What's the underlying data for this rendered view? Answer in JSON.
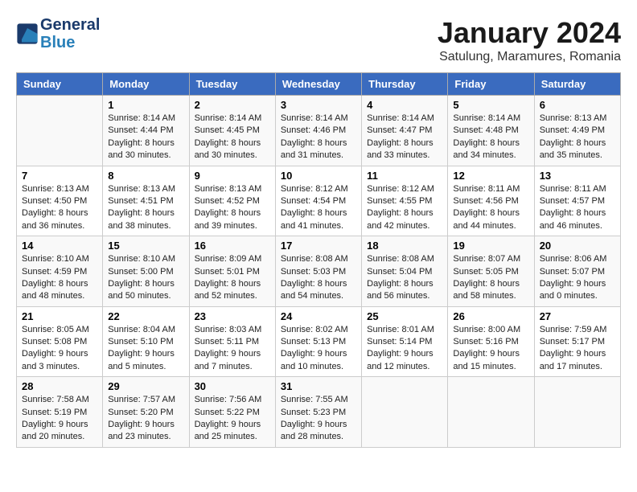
{
  "header": {
    "logo_line1": "General",
    "logo_line2": "Blue",
    "title": "January 2024",
    "subtitle": "Satulung, Maramures, Romania"
  },
  "weekdays": [
    "Sunday",
    "Monday",
    "Tuesday",
    "Wednesday",
    "Thursday",
    "Friday",
    "Saturday"
  ],
  "weeks": [
    [
      {
        "day": "",
        "info": ""
      },
      {
        "day": "1",
        "info": "Sunrise: 8:14 AM\nSunset: 4:44 PM\nDaylight: 8 hours\nand 30 minutes."
      },
      {
        "day": "2",
        "info": "Sunrise: 8:14 AM\nSunset: 4:45 PM\nDaylight: 8 hours\nand 30 minutes."
      },
      {
        "day": "3",
        "info": "Sunrise: 8:14 AM\nSunset: 4:46 PM\nDaylight: 8 hours\nand 31 minutes."
      },
      {
        "day": "4",
        "info": "Sunrise: 8:14 AM\nSunset: 4:47 PM\nDaylight: 8 hours\nand 33 minutes."
      },
      {
        "day": "5",
        "info": "Sunrise: 8:14 AM\nSunset: 4:48 PM\nDaylight: 8 hours\nand 34 minutes."
      },
      {
        "day": "6",
        "info": "Sunrise: 8:13 AM\nSunset: 4:49 PM\nDaylight: 8 hours\nand 35 minutes."
      }
    ],
    [
      {
        "day": "7",
        "info": "Sunrise: 8:13 AM\nSunset: 4:50 PM\nDaylight: 8 hours\nand 36 minutes."
      },
      {
        "day": "8",
        "info": "Sunrise: 8:13 AM\nSunset: 4:51 PM\nDaylight: 8 hours\nand 38 minutes."
      },
      {
        "day": "9",
        "info": "Sunrise: 8:13 AM\nSunset: 4:52 PM\nDaylight: 8 hours\nand 39 minutes."
      },
      {
        "day": "10",
        "info": "Sunrise: 8:12 AM\nSunset: 4:54 PM\nDaylight: 8 hours\nand 41 minutes."
      },
      {
        "day": "11",
        "info": "Sunrise: 8:12 AM\nSunset: 4:55 PM\nDaylight: 8 hours\nand 42 minutes."
      },
      {
        "day": "12",
        "info": "Sunrise: 8:11 AM\nSunset: 4:56 PM\nDaylight: 8 hours\nand 44 minutes."
      },
      {
        "day": "13",
        "info": "Sunrise: 8:11 AM\nSunset: 4:57 PM\nDaylight: 8 hours\nand 46 minutes."
      }
    ],
    [
      {
        "day": "14",
        "info": "Sunrise: 8:10 AM\nSunset: 4:59 PM\nDaylight: 8 hours\nand 48 minutes."
      },
      {
        "day": "15",
        "info": "Sunrise: 8:10 AM\nSunset: 5:00 PM\nDaylight: 8 hours\nand 50 minutes."
      },
      {
        "day": "16",
        "info": "Sunrise: 8:09 AM\nSunset: 5:01 PM\nDaylight: 8 hours\nand 52 minutes."
      },
      {
        "day": "17",
        "info": "Sunrise: 8:08 AM\nSunset: 5:03 PM\nDaylight: 8 hours\nand 54 minutes."
      },
      {
        "day": "18",
        "info": "Sunrise: 8:08 AM\nSunset: 5:04 PM\nDaylight: 8 hours\nand 56 minutes."
      },
      {
        "day": "19",
        "info": "Sunrise: 8:07 AM\nSunset: 5:05 PM\nDaylight: 8 hours\nand 58 minutes."
      },
      {
        "day": "20",
        "info": "Sunrise: 8:06 AM\nSunset: 5:07 PM\nDaylight: 9 hours\nand 0 minutes."
      }
    ],
    [
      {
        "day": "21",
        "info": "Sunrise: 8:05 AM\nSunset: 5:08 PM\nDaylight: 9 hours\nand 3 minutes."
      },
      {
        "day": "22",
        "info": "Sunrise: 8:04 AM\nSunset: 5:10 PM\nDaylight: 9 hours\nand 5 minutes."
      },
      {
        "day": "23",
        "info": "Sunrise: 8:03 AM\nSunset: 5:11 PM\nDaylight: 9 hours\nand 7 minutes."
      },
      {
        "day": "24",
        "info": "Sunrise: 8:02 AM\nSunset: 5:13 PM\nDaylight: 9 hours\nand 10 minutes."
      },
      {
        "day": "25",
        "info": "Sunrise: 8:01 AM\nSunset: 5:14 PM\nDaylight: 9 hours\nand 12 minutes."
      },
      {
        "day": "26",
        "info": "Sunrise: 8:00 AM\nSunset: 5:16 PM\nDaylight: 9 hours\nand 15 minutes."
      },
      {
        "day": "27",
        "info": "Sunrise: 7:59 AM\nSunset: 5:17 PM\nDaylight: 9 hours\nand 17 minutes."
      }
    ],
    [
      {
        "day": "28",
        "info": "Sunrise: 7:58 AM\nSunset: 5:19 PM\nDaylight: 9 hours\nand 20 minutes."
      },
      {
        "day": "29",
        "info": "Sunrise: 7:57 AM\nSunset: 5:20 PM\nDaylight: 9 hours\nand 23 minutes."
      },
      {
        "day": "30",
        "info": "Sunrise: 7:56 AM\nSunset: 5:22 PM\nDaylight: 9 hours\nand 25 minutes."
      },
      {
        "day": "31",
        "info": "Sunrise: 7:55 AM\nSunset: 5:23 PM\nDaylight: 9 hours\nand 28 minutes."
      },
      {
        "day": "",
        "info": ""
      },
      {
        "day": "",
        "info": ""
      },
      {
        "day": "",
        "info": ""
      }
    ]
  ]
}
